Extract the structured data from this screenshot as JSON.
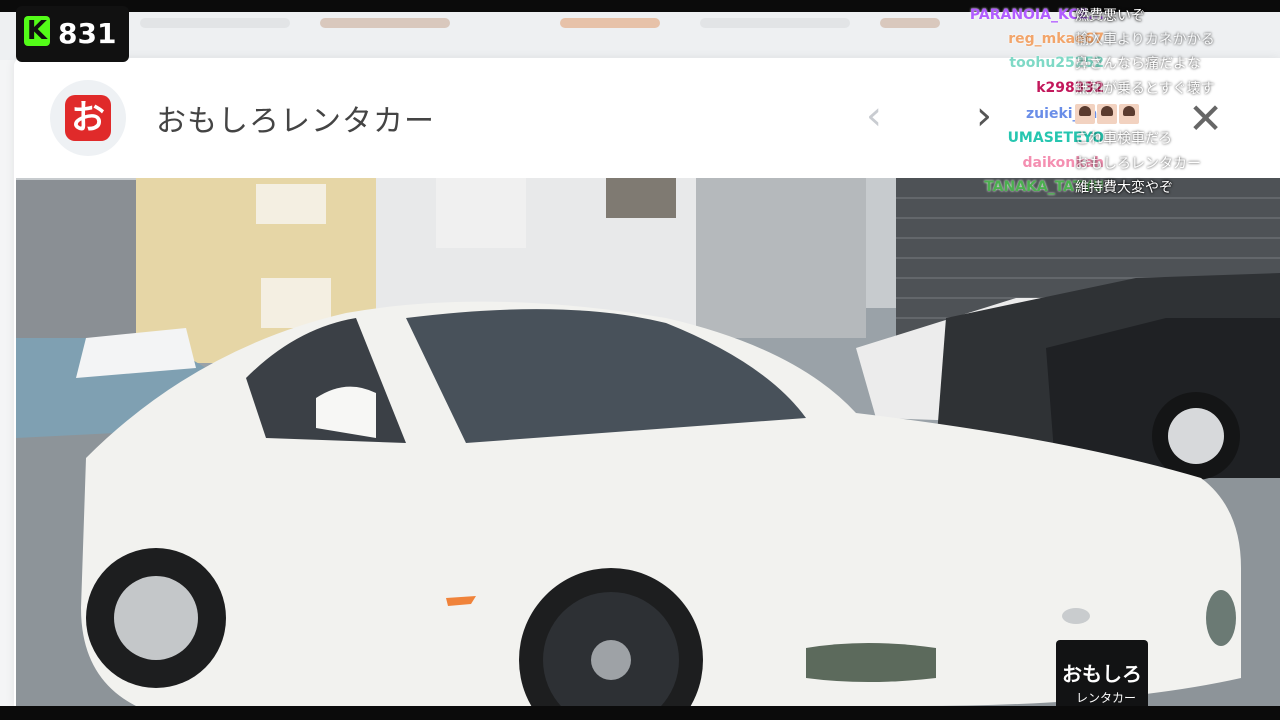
{
  "modal": {
    "logo_glyph": "お",
    "title": "おもしろレンタカー",
    "prev_glyph": "‹",
    "next_glyph": "›",
    "close_glyph": "✕"
  },
  "photo": {
    "plate_line1": "おもしろ",
    "plate_line2": "レンタカー"
  },
  "overlay": {
    "k_glyph": "K",
    "viewer_count": "831"
  },
  "chat": [
    {
      "user": "PARANOIA_KCE...",
      "color": "#b15cff",
      "message": "燃費悪いぞ"
    },
    {
      "user": "reg_mkae67",
      "color": "#f2a56b",
      "message": "輸入車よりカネかかる"
    },
    {
      "user": "toohu25252",
      "color": "#7fd9c6",
      "message": "鼻さんなら痛だよな"
    },
    {
      "user": "k298332",
      "color": "#c2185b",
      "message": "無知が乗るとすぐ壊す"
    },
    {
      "user": "zuieki_cat",
      "color": "#6a8ee8",
      "message": "",
      "emotes": 3
    },
    {
      "user": "UMASETEYO",
      "color": "#26c6b0",
      "message": "これ車検車だろ"
    },
    {
      "user": "daikonkah",
      "color": "#f48fb1",
      "message": "おもしろレンタカー"
    },
    {
      "user": "TANAKA_TATYU",
      "color": "#4caf50",
      "message": "維持費大変やぞ"
    }
  ],
  "colors": {
    "kick_green": "#53fc18",
    "logo_red": "#e02a2a"
  },
  "icons": [
    "kick-logo-icon",
    "chevron-left-icon",
    "chevron-right-icon",
    "close-icon"
  ]
}
